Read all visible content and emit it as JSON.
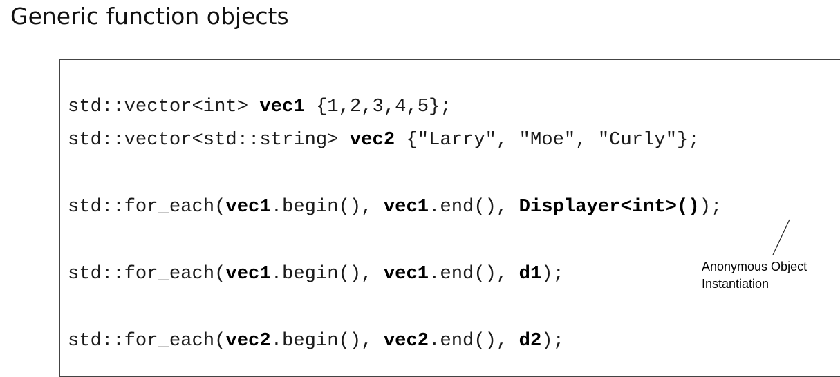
{
  "slide": {
    "title": "Generic function objects"
  },
  "code": {
    "line1": {
      "a": "std::vector<int> ",
      "b": "vec1",
      "c": " {1,2,3,4,5};"
    },
    "line2": {
      "a": "std::vector<std::string> ",
      "b": "vec2",
      "c": " {\"Larry\", \"Moe\", \"Curly\"};"
    },
    "line3": {
      "a": "std::for_each(",
      "b": "vec1",
      "c": ".begin(), ",
      "d": "vec1",
      "e": ".end(), ",
      "f": "Displayer<int>()",
      "g": ");"
    },
    "line4": {
      "a": "std::for_each(",
      "b": "vec1",
      "c": ".begin(), ",
      "d": "vec1",
      "e": ".end(), ",
      "f": "d1",
      "g": ");"
    },
    "line5": {
      "a": "std::for_each(",
      "b": "vec2",
      "c": ".begin(), ",
      "d": "vec2",
      "e": ".end(), ",
      "f": "d2",
      "g": ");"
    }
  },
  "annotation": {
    "line1": "Anonymous Object",
    "line2": "Instantiation"
  }
}
